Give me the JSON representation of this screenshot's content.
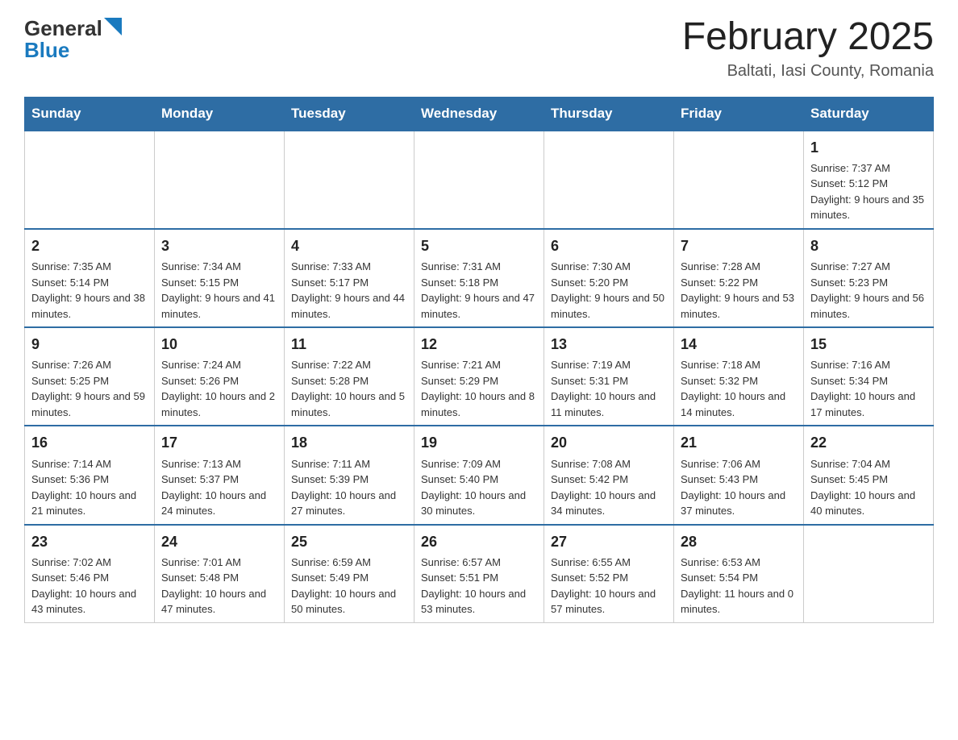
{
  "logo": {
    "general": "General",
    "blue": "Blue"
  },
  "title": "February 2025",
  "subtitle": "Baltati, Iasi County, Romania",
  "days_of_week": [
    "Sunday",
    "Monday",
    "Tuesday",
    "Wednesday",
    "Thursday",
    "Friday",
    "Saturday"
  ],
  "weeks": [
    [
      {
        "day": "",
        "info": ""
      },
      {
        "day": "",
        "info": ""
      },
      {
        "day": "",
        "info": ""
      },
      {
        "day": "",
        "info": ""
      },
      {
        "day": "",
        "info": ""
      },
      {
        "day": "",
        "info": ""
      },
      {
        "day": "1",
        "info": "Sunrise: 7:37 AM\nSunset: 5:12 PM\nDaylight: 9 hours and 35 minutes."
      }
    ],
    [
      {
        "day": "2",
        "info": "Sunrise: 7:35 AM\nSunset: 5:14 PM\nDaylight: 9 hours and 38 minutes."
      },
      {
        "day": "3",
        "info": "Sunrise: 7:34 AM\nSunset: 5:15 PM\nDaylight: 9 hours and 41 minutes."
      },
      {
        "day": "4",
        "info": "Sunrise: 7:33 AM\nSunset: 5:17 PM\nDaylight: 9 hours and 44 minutes."
      },
      {
        "day": "5",
        "info": "Sunrise: 7:31 AM\nSunset: 5:18 PM\nDaylight: 9 hours and 47 minutes."
      },
      {
        "day": "6",
        "info": "Sunrise: 7:30 AM\nSunset: 5:20 PM\nDaylight: 9 hours and 50 minutes."
      },
      {
        "day": "7",
        "info": "Sunrise: 7:28 AM\nSunset: 5:22 PM\nDaylight: 9 hours and 53 minutes."
      },
      {
        "day": "8",
        "info": "Sunrise: 7:27 AM\nSunset: 5:23 PM\nDaylight: 9 hours and 56 minutes."
      }
    ],
    [
      {
        "day": "9",
        "info": "Sunrise: 7:26 AM\nSunset: 5:25 PM\nDaylight: 9 hours and 59 minutes."
      },
      {
        "day": "10",
        "info": "Sunrise: 7:24 AM\nSunset: 5:26 PM\nDaylight: 10 hours and 2 minutes."
      },
      {
        "day": "11",
        "info": "Sunrise: 7:22 AM\nSunset: 5:28 PM\nDaylight: 10 hours and 5 minutes."
      },
      {
        "day": "12",
        "info": "Sunrise: 7:21 AM\nSunset: 5:29 PM\nDaylight: 10 hours and 8 minutes."
      },
      {
        "day": "13",
        "info": "Sunrise: 7:19 AM\nSunset: 5:31 PM\nDaylight: 10 hours and 11 minutes."
      },
      {
        "day": "14",
        "info": "Sunrise: 7:18 AM\nSunset: 5:32 PM\nDaylight: 10 hours and 14 minutes."
      },
      {
        "day": "15",
        "info": "Sunrise: 7:16 AM\nSunset: 5:34 PM\nDaylight: 10 hours and 17 minutes."
      }
    ],
    [
      {
        "day": "16",
        "info": "Sunrise: 7:14 AM\nSunset: 5:36 PM\nDaylight: 10 hours and 21 minutes."
      },
      {
        "day": "17",
        "info": "Sunrise: 7:13 AM\nSunset: 5:37 PM\nDaylight: 10 hours and 24 minutes."
      },
      {
        "day": "18",
        "info": "Sunrise: 7:11 AM\nSunset: 5:39 PM\nDaylight: 10 hours and 27 minutes."
      },
      {
        "day": "19",
        "info": "Sunrise: 7:09 AM\nSunset: 5:40 PM\nDaylight: 10 hours and 30 minutes."
      },
      {
        "day": "20",
        "info": "Sunrise: 7:08 AM\nSunset: 5:42 PM\nDaylight: 10 hours and 34 minutes."
      },
      {
        "day": "21",
        "info": "Sunrise: 7:06 AM\nSunset: 5:43 PM\nDaylight: 10 hours and 37 minutes."
      },
      {
        "day": "22",
        "info": "Sunrise: 7:04 AM\nSunset: 5:45 PM\nDaylight: 10 hours and 40 minutes."
      }
    ],
    [
      {
        "day": "23",
        "info": "Sunrise: 7:02 AM\nSunset: 5:46 PM\nDaylight: 10 hours and 43 minutes."
      },
      {
        "day": "24",
        "info": "Sunrise: 7:01 AM\nSunset: 5:48 PM\nDaylight: 10 hours and 47 minutes."
      },
      {
        "day": "25",
        "info": "Sunrise: 6:59 AM\nSunset: 5:49 PM\nDaylight: 10 hours and 50 minutes."
      },
      {
        "day": "26",
        "info": "Sunrise: 6:57 AM\nSunset: 5:51 PM\nDaylight: 10 hours and 53 minutes."
      },
      {
        "day": "27",
        "info": "Sunrise: 6:55 AM\nSunset: 5:52 PM\nDaylight: 10 hours and 57 minutes."
      },
      {
        "day": "28",
        "info": "Sunrise: 6:53 AM\nSunset: 5:54 PM\nDaylight: 11 hours and 0 minutes."
      },
      {
        "day": "",
        "info": ""
      }
    ]
  ]
}
